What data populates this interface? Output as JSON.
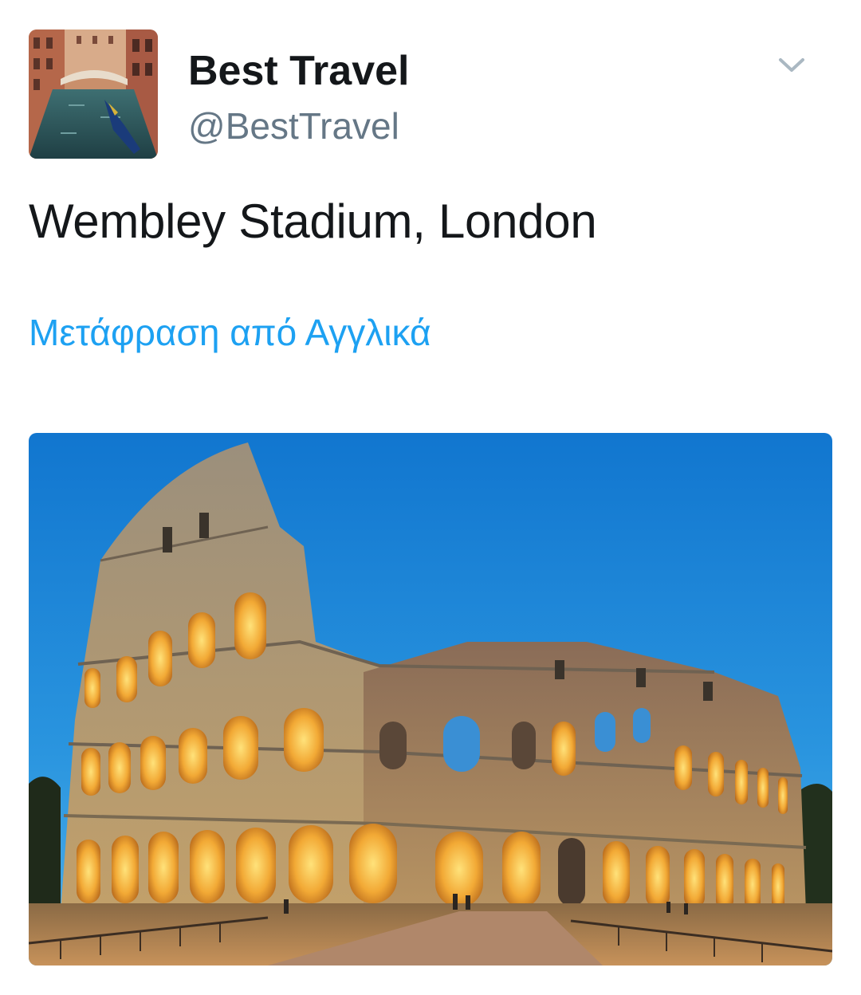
{
  "tweet": {
    "author": {
      "display_name": "Best Travel",
      "handle": "@BestTravel",
      "avatar_icon": "venice-canal-photo"
    },
    "text": "Wembley Stadium, London",
    "translate_label": "Μετάφραση από Αγγλικά",
    "menu_icon": "chevron-down-icon",
    "media_image": "colosseum-at-dusk-photo"
  },
  "colors": {
    "name": "#14171a",
    "handle": "#657786",
    "link": "#1da1f2",
    "caret": "#aab8c2",
    "sky": "#1e88d6"
  }
}
